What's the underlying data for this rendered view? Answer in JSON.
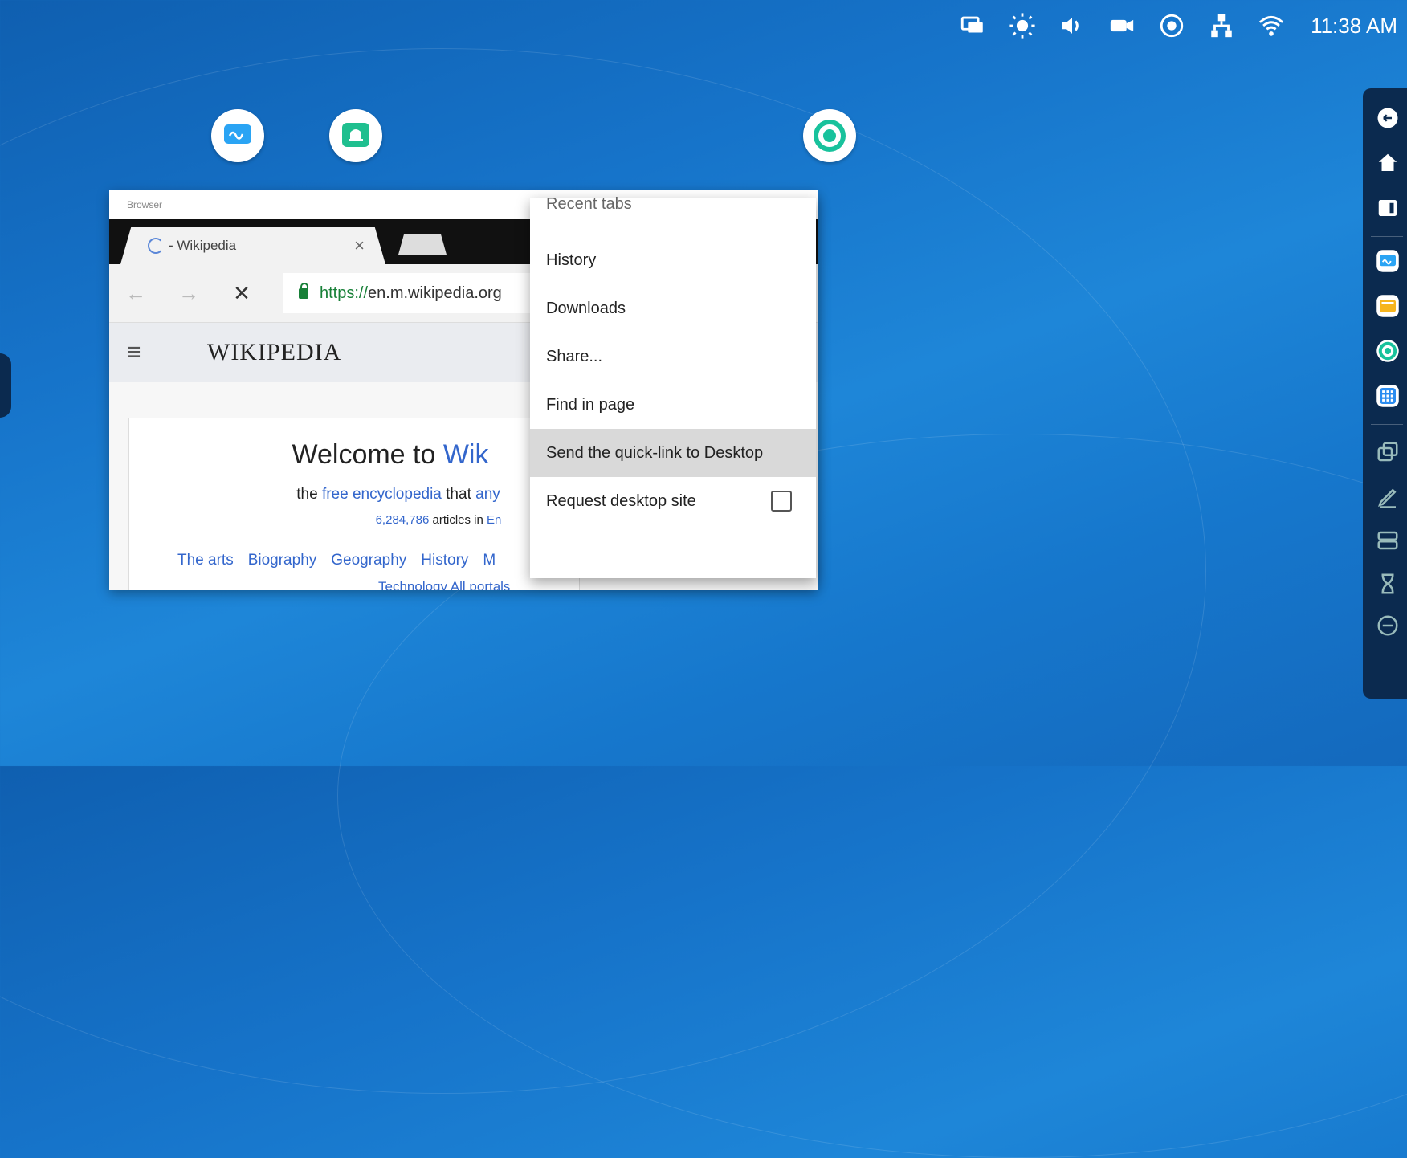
{
  "status_bar": {
    "icons": [
      "screen-mirror-icon",
      "brightness-icon",
      "volume-icon",
      "camera-icon",
      "signal-icon",
      "network-icon",
      "wifi-icon"
    ],
    "time": "11:38 AM"
  },
  "desktop_icons": [
    {
      "icon": "whiteboard-app-icon"
    },
    {
      "icon": "bell-app-icon"
    },
    {
      "icon": "ring-app-icon"
    }
  ],
  "browser": {
    "window_title": "Browser",
    "tab_title": "- Wikipedia",
    "tab_close": "×",
    "url_scheme": "https://",
    "url_rest": "en.m.wikipedia.org",
    "nav": {
      "back": "←",
      "forward": "→",
      "stop": "✕"
    },
    "wiki": {
      "menu_glyph": "≡",
      "logo": "WIKIPEDIA",
      "welcome_prefix": "Welcome to ",
      "welcome_link": "Wik",
      "tagline_pre": "the ",
      "tagline_link": "free encyclopedia",
      "tagline_mid": " that ",
      "tagline_link2": "any",
      "article_count": "6,284,786",
      "article_text": " articles in ",
      "article_lang": "En",
      "portals": [
        "The arts",
        "Biography",
        "Geography",
        "History",
        "M"
      ],
      "portals_row2": "Technology   All portals"
    }
  },
  "context_menu": {
    "items": [
      {
        "label": "Recent tabs",
        "partial": true
      },
      {
        "label": "History"
      },
      {
        "label": "Downloads"
      },
      {
        "label": "Share..."
      },
      {
        "label": "Find in page"
      },
      {
        "label": "Send the quick-link to Desktop",
        "highlighted": true
      },
      {
        "label": "Request desktop site",
        "checkbox": false
      }
    ]
  },
  "dock": {
    "items": [
      "back-icon",
      "home-icon",
      "window-icon",
      "whiteboard-app-icon",
      "folder-app-icon",
      "ring-app-icon",
      "apps-grid-icon",
      "multi-window-icon",
      "pen-icon",
      "storage-icon",
      "hourglass-icon",
      "minus-circle-icon"
    ]
  }
}
